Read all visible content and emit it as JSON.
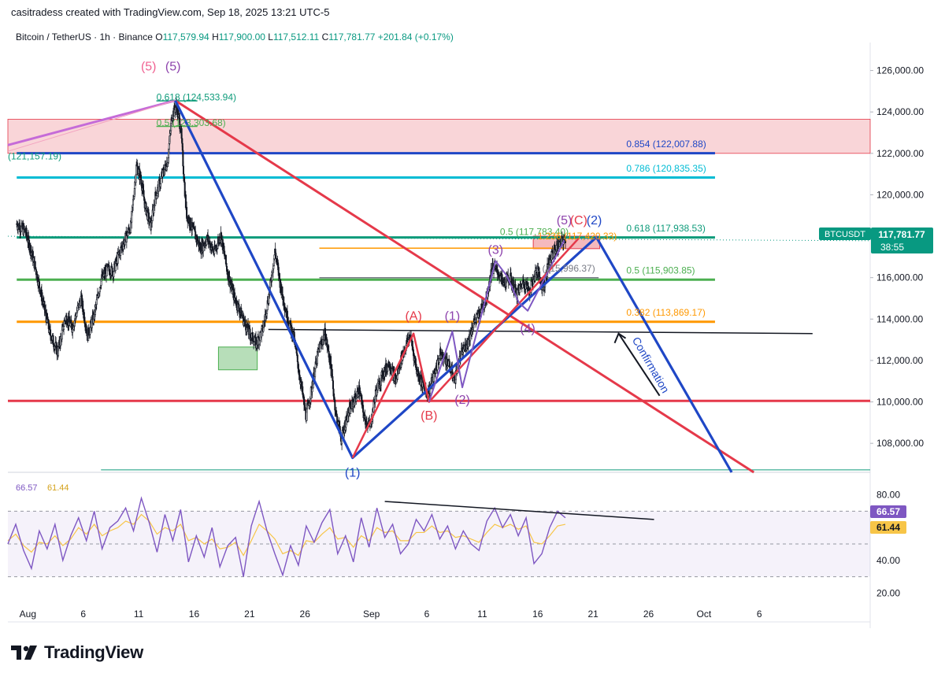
{
  "header": {
    "attribution": "casitradess created with TradingView.com, Sep 18, 2025 13:21 UTC-5"
  },
  "symbol_bar": {
    "name": "Bitcoin / TetherUS · 1h · Binance",
    "open_key": "O",
    "open": "117,579.94",
    "high_key": "H",
    "high": "117,900.00",
    "low_key": "L",
    "low": "117,512.11",
    "close_key": "C",
    "close": "117,781.77",
    "change": "+201.84 (+0.17%)"
  },
  "price_tag": {
    "symbol": "BTCUSDT",
    "price": "117,781.77",
    "countdown": "38:55"
  },
  "rsi": {
    "label_1": "66.57",
    "label_2": "61.44",
    "tag_1": "66.57",
    "tag_2": "61.44"
  },
  "logo": {
    "text": "TradingView"
  },
  "colors": {
    "up": "#089981",
    "down": "#f23645",
    "candle": "#131722",
    "blue_line": "#1f47c6",
    "red_line": "#e5394a",
    "rsi": "#7e57c2",
    "rsi_ma": "#f7c548"
  },
  "chart_data": [
    {
      "type": "candlestick",
      "title": "Bitcoin / TetherUS · 1h · Binance",
      "price_axis": [
        "126,000.00",
        "124,000.00",
        "122,000.00",
        "120,000.00",
        "118,000.00",
        "116,000.00",
        "114,000.00",
        "112,000.00",
        "110,000.00",
        "108,000.00"
      ],
      "ylim": [
        106600,
        127200
      ],
      "x_tick_labels": [
        "Aug",
        "6",
        "11",
        "16",
        "21",
        "26",
        "Sep",
        "6",
        "11",
        "16",
        "21",
        "26",
        "Oct",
        "6"
      ],
      "x_tick_days": [
        1,
        6,
        11,
        16,
        21,
        26,
        32,
        37,
        42,
        47,
        52,
        57,
        62,
        67
      ],
      "xlim_days": [
        -0.8,
        77
      ],
      "price_path": [
        [
          0,
          118600
        ],
        [
          0.8,
          118200
        ],
        [
          1.5,
          116900
        ],
        [
          2.2,
          115200
        ],
        [
          3,
          113300
        ],
        [
          3.7,
          112400
        ],
        [
          4.4,
          114100
        ],
        [
          5,
          113600
        ],
        [
          5.8,
          115000
        ],
        [
          6.4,
          113200
        ],
        [
          7,
          114200
        ],
        [
          7.6,
          115900
        ],
        [
          8.2,
          116400
        ],
        [
          8.7,
          116300
        ],
        [
          9.2,
          117100
        ],
        [
          9.8,
          117900
        ],
        [
          10.3,
          118500
        ],
        [
          10.8,
          121400
        ],
        [
          11.2,
          120800
        ],
        [
          11.6,
          119400
        ],
        [
          12.1,
          118500
        ],
        [
          12.5,
          119900
        ],
        [
          13.1,
          120900
        ],
        [
          13.6,
          121600
        ],
        [
          14,
          123800
        ],
        [
          14.4,
          124300
        ],
        [
          14.8,
          123200
        ],
        [
          15.3,
          119100
        ],
        [
          15.9,
          118300
        ],
        [
          16.6,
          117400
        ],
        [
          17.2,
          117900
        ],
        [
          17.8,
          117200
        ],
        [
          18.4,
          118100
        ],
        [
          19,
          116300
        ],
        [
          19.6,
          115100
        ],
        [
          20.2,
          114300
        ],
        [
          20.9,
          113400
        ],
        [
          21.6,
          112800
        ],
        [
          22.2,
          113500
        ],
        [
          22.8,
          115300
        ],
        [
          23.3,
          117300
        ],
        [
          23.8,
          115600
        ],
        [
          24.4,
          114100
        ],
        [
          25,
          113100
        ],
        [
          25.6,
          111000
        ],
        [
          26.1,
          109300
        ],
        [
          26.6,
          110600
        ],
        [
          27.2,
          112400
        ],
        [
          27.8,
          113300
        ],
        [
          28.3,
          111900
        ],
        [
          28.8,
          109400
        ],
        [
          29.3,
          108200
        ],
        [
          29.8,
          109300
        ],
        [
          30.3,
          109900
        ],
        [
          30.9,
          110600
        ],
        [
          31.4,
          109100
        ],
        [
          31.9,
          108800
        ],
        [
          32.4,
          110500
        ],
        [
          33,
          111300
        ],
        [
          33.6,
          111900
        ],
        [
          34.2,
          111000
        ],
        [
          34.8,
          112300
        ],
        [
          35.5,
          113200
        ],
        [
          36.1,
          111500
        ],
        [
          36.6,
          110900
        ],
        [
          37.1,
          110400
        ],
        [
          37.6,
          111200
        ],
        [
          38.2,
          112300
        ],
        [
          38.8,
          112000
        ],
        [
          39.5,
          111100
        ],
        [
          40.1,
          112300
        ],
        [
          40.7,
          112900
        ],
        [
          41.2,
          113800
        ],
        [
          41.8,
          114300
        ],
        [
          42.4,
          115100
        ],
        [
          42.9,
          116500
        ],
        [
          43.4,
          116300
        ],
        [
          43.9,
          115700
        ],
        [
          44.5,
          116000
        ],
        [
          45.1,
          115200
        ],
        [
          45.7,
          115800
        ],
        [
          46.3,
          115400
        ],
        [
          46.9,
          116400
        ],
        [
          47.5,
          115500
        ],
        [
          48,
          116700
        ],
        [
          48.5,
          117300
        ],
        [
          49,
          117600
        ],
        [
          49.5,
          117900
        ]
      ],
      "horizontal_levels": [
        {
          "price": 122007.88,
          "color": "#1f47c6"
        },
        {
          "price": 120835.35,
          "color": "#00bcd4"
        },
        {
          "price": 117938.53,
          "color": "#0d9b7a"
        },
        {
          "price": 115903.85,
          "color": "#4caf50"
        },
        {
          "price": 113869.17,
          "color": "#ff9800"
        },
        {
          "price": 110050,
          "color": "#e5394a"
        }
      ],
      "fib_labels": [
        {
          "text": "0.618 (124,533.94)",
          "day": 12.6,
          "price": 124550,
          "color": "#0d9b7a"
        },
        {
          "text": "0.5 (123,303.68)",
          "day": 12.6,
          "price": 123320,
          "color": "#4caf50"
        },
        {
          "text": "(121,157.19)",
          "day": -0.8,
          "price": 121700,
          "color": "#0d9b7a"
        },
        {
          "text": "0.854 (122,007.88)",
          "day": 55,
          "price": 122300,
          "color": "#1f47c6"
        },
        {
          "text": "0.786 (120,835.35)",
          "day": 55,
          "price": 121125,
          "color": "#00bcd4"
        },
        {
          "text": "0.618 (117,938.53)",
          "day": 55,
          "price": 118230,
          "color": "#0d9b7a"
        },
        {
          "text": "0.5 (117,783.40)",
          "day": 43.6,
          "price": 118060,
          "color": "#4caf50"
        },
        {
          "text": "1.236 (117,420.33)",
          "day": 47,
          "price": 117850,
          "color": "#ff9800"
        },
        {
          "text": "1 (115,996.37)",
          "day": 46.7,
          "price": 116290,
          "color": "#787b86"
        },
        {
          "text": "0.5 (115,903.85)",
          "day": 55,
          "price": 116200,
          "color": "#4caf50"
        },
        {
          "text": "0.382 (113,869.17)",
          "day": 55,
          "price": 114160,
          "color": "#ff9800"
        }
      ],
      "wave_labels": [
        {
          "text": "(5)",
          "day": 11.9,
          "price": 126000,
          "color": "#f06292"
        },
        {
          "text": "(5)",
          "day": 14.1,
          "price": 126000,
          "color": "#8e44ad"
        },
        {
          "text": "(A)",
          "day": 35.8,
          "price": 113950,
          "color": "#e5394a"
        },
        {
          "text": "(B)",
          "day": 37.2,
          "price": 109150,
          "color": "#e5394a"
        },
        {
          "text": "(1)",
          "day": 39.3,
          "price": 113950,
          "color": "#8e44ad"
        },
        {
          "text": "(2)",
          "day": 40.2,
          "price": 109900,
          "color": "#8e44ad"
        },
        {
          "text": "(3)",
          "day": 43.2,
          "price": 117150,
          "color": "#8e44ad"
        },
        {
          "text": "(4)",
          "day": 46.1,
          "price": 113350,
          "color": "#8e44ad"
        },
        {
          "text": "(5)",
          "day": 49.4,
          "price": 118580,
          "color": "#8e44ad"
        },
        {
          "text": "(C)",
          "day": 50.7,
          "price": 118580,
          "color": "#e5394a"
        },
        {
          "text": "(2)",
          "day": 52.1,
          "price": 118580,
          "color": "#1f47c6"
        },
        {
          "text": "(1)",
          "day": 30.3,
          "price": 106400,
          "color": "#1f47c6"
        }
      ],
      "annotation": {
        "text": "Confirmation",
        "color": "#1f47c6"
      }
    },
    {
      "type": "line",
      "title": "RSI",
      "price_axis": [
        "80.00",
        "40.00",
        "20.00"
      ],
      "ylim": [
        12,
        88
      ],
      "bands": [
        70,
        50,
        30
      ],
      "series": [
        {
          "values": [
            50,
            62,
            46,
            35,
            58,
            47,
            62,
            40,
            55,
            66,
            52,
            70,
            47,
            60,
            64,
            72,
            58,
            78,
            63,
            45,
            68,
            52,
            71,
            39,
            55,
            42,
            60,
            36,
            49,
            54,
            30,
            61,
            76,
            58,
            44,
            31,
            49,
            37,
            61,
            51,
            63,
            71,
            44,
            55,
            39,
            66,
            48,
            72,
            54,
            62,
            44,
            50,
            65,
            58,
            68,
            53,
            61,
            47,
            58,
            50,
            46,
            64,
            72,
            60,
            68,
            55,
            66,
            38,
            44,
            60,
            70,
            66
          ]
        },
        {
          "values": [
            52,
            56,
            49,
            45,
            51,
            50,
            55,
            49,
            53,
            60,
            56,
            62,
            55,
            58,
            60,
            64,
            62,
            68,
            64,
            56,
            60,
            58,
            62,
            52,
            54,
            50,
            53,
            47,
            48,
            51,
            43,
            52,
            62,
            58,
            53,
            44,
            46,
            43,
            52,
            51,
            56,
            60,
            53,
            54,
            48,
            55,
            52,
            60,
            57,
            58,
            52,
            52,
            57,
            57,
            61,
            57,
            58,
            54,
            55,
            53,
            51,
            57,
            62,
            60,
            62,
            59,
            61,
            51,
            50,
            55,
            61,
            62
          ]
        }
      ]
    }
  ]
}
